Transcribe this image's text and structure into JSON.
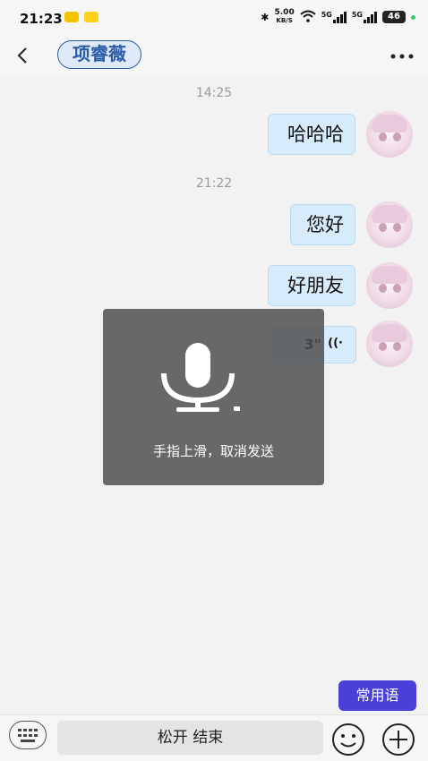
{
  "status_bar": {
    "time": "21:23",
    "net_speed_value": "5.00",
    "net_speed_unit": "KB/S",
    "signal1_label": "5G",
    "signal2_label": "5G",
    "battery": "46"
  },
  "header": {
    "back_icon": "chevron-left-icon",
    "contact_name": "项睿薇",
    "more_icon": "ellipsis-icon"
  },
  "messages": [
    {
      "time": "14:25"
    },
    {
      "text": "哈哈哈"
    },
    {
      "time": "21:22"
    },
    {
      "text": "您好"
    },
    {
      "text": "好朋友"
    },
    {
      "voice_duration": "3\""
    }
  ],
  "recording": {
    "icon": "microphone-icon",
    "hint": "手指上滑，取消发送"
  },
  "phrases_button": "常用语",
  "input_bar": {
    "keyboard_icon": "keyboard-icon",
    "hold_label": "松开 结束",
    "emoji_icon": "emoji-icon",
    "plus_icon": "plus-icon"
  },
  "colors": {
    "accent": "#4a3fd6",
    "bubble": "#d7ecfb",
    "contact_text": "#2b5ca8"
  }
}
